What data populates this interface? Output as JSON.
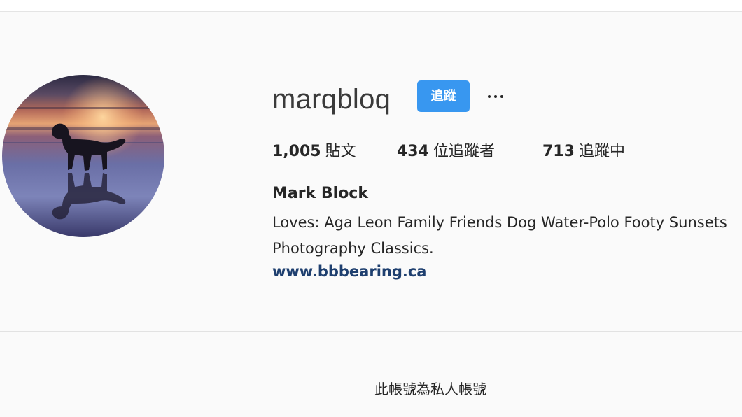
{
  "profile": {
    "username": "marqbloq",
    "follow_label": "追蹤",
    "more_label": "···",
    "full_name": "Mark Block",
    "bio": "Loves: Aga Leon Family Friends Dog Water-Polo Footy Sunsets\nPhotography Classics.",
    "website": "www.bbbearing.ca"
  },
  "stats": {
    "posts_count": "1,005",
    "posts_label": "貼文",
    "followers_count": "434",
    "followers_label": "位追蹤者",
    "following_count": "713",
    "following_label": "追蹤中"
  },
  "notice": {
    "private_text": "此帳號為私人帳號"
  },
  "colors": {
    "follow_button": "#3897f0",
    "link": "#1e3f6f",
    "background": "#fafafa"
  },
  "icons": {
    "more": "more-options-icon"
  }
}
